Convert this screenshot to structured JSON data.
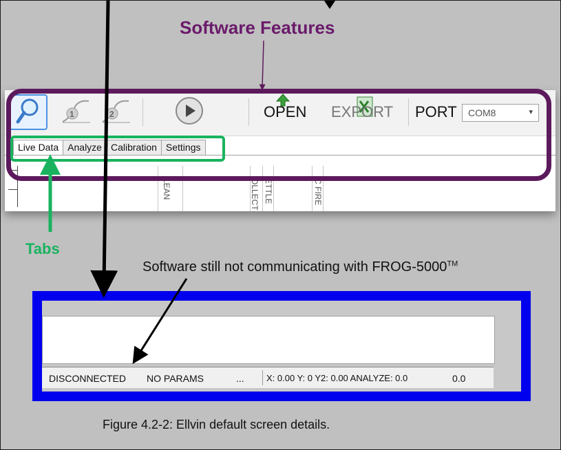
{
  "annotations": {
    "features_title": "Software Features",
    "tabs_label": "Tabs",
    "note_text": "Software still not communicating with FROG-5000",
    "note_sup": "TM",
    "caption": "Figure 4.2-2: Ellvin default screen details."
  },
  "toolbar": {
    "graph1_label": "1",
    "graph2_label": "2",
    "open_label": "OPEN",
    "export_label": "EXPORT",
    "port_label": "PORT",
    "port_value": "COM8"
  },
  "tabs": [
    {
      "label": "Live Data"
    },
    {
      "label": "Analyze"
    },
    {
      "label": "Calibration"
    },
    {
      "label": "Settings"
    }
  ],
  "channel_labels": [
    "LEAN",
    "OLLECT",
    "ETTLE",
    "C FIRE"
  ],
  "statusbar": {
    "connection": "DISCONNECTED",
    "params": "NO PARAMS",
    "ellipsis": "...",
    "readout": "X: 0.00  Y: 0  Y2: 0.00  ANALYZE: 0.0",
    "value": "0.0"
  },
  "colors": {
    "features_accent": "#5c1a5c",
    "tabs_accent": "#19b35f",
    "status_accent": "#0000ee"
  }
}
